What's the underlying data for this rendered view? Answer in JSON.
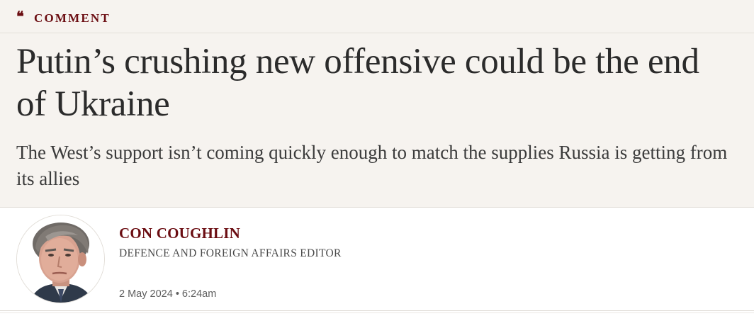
{
  "section": {
    "icon": "quote-mark-icon",
    "icon_glyph": "❝",
    "label": "COMMENT",
    "accent_color": "#6b0d12"
  },
  "article": {
    "headline": "Putin’s crushing new offensive could be the end of Ukraine",
    "standfirst": "The West’s support isn’t coming quickly enough to match the supplies Russia is getting from its allies"
  },
  "byline": {
    "avatar": "author-photo",
    "author_name": "CON COUGHLIN",
    "author_role": "DEFENCE AND FOREIGN AFFAIRS EDITOR",
    "date": "2 May 2024",
    "separator": "•",
    "time": "6:24am"
  }
}
